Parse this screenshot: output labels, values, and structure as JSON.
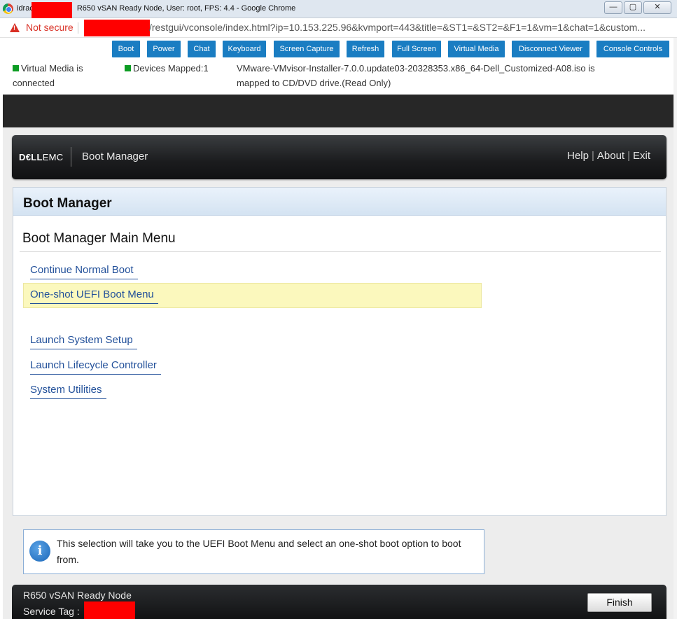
{
  "window": {
    "title_prefix": "idrac",
    "title_suffix": "R650 vSAN Ready Node, User: root, FPS: 4.4 - Google Chrome",
    "minimize": "—",
    "maximize": "▢",
    "close": "✕"
  },
  "addressbar": {
    "security_label": "Not secure",
    "url": "/restgui/vconsole/index.html?ip=10.153.225.96&kvmport=443&title=&ST1=&ST2=&F1=1&vm=1&chat=1&custom..."
  },
  "toolbar": {
    "buttons": [
      "Boot",
      "Power",
      "Chat",
      "Keyboard",
      "Screen Capture",
      "Refresh",
      "Full Screen",
      "Virtual Media",
      "Disconnect Viewer",
      "Console Controls"
    ]
  },
  "status": {
    "virtual_media_line1": "Virtual Media is",
    "virtual_media_line2": "connected",
    "devices_mapped": "Devices Mapped:1",
    "iso_line1": "VMware-VMvisor-Installer-7.0.0.update03-20328353.x86_64-Dell_Customized-A08.iso is",
    "iso_line2": "mapped to CD/DVD drive.(Read Only)"
  },
  "header": {
    "logo_bold": "D€LL",
    "logo_rest": "EMC",
    "title": "Boot Manager",
    "help": "Help",
    "about": "About",
    "exit": "Exit",
    "sep": "|"
  },
  "panel": {
    "title": "Boot Manager",
    "menu_title": "Boot Manager Main Menu",
    "items": [
      "Continue Normal Boot",
      "One-shot UEFI Boot Menu",
      "Launch System Setup",
      "Launch Lifecycle Controller",
      "System Utilities"
    ],
    "selected_index": 1
  },
  "help": {
    "icon": "i",
    "text": "This selection will take you to the UEFI Boot Menu and select an one-shot boot option to boot from."
  },
  "footer": {
    "model": "R650 vSAN Ready Node",
    "service_tag_label": "Service Tag :",
    "finish": "Finish"
  },
  "colors": {
    "toolbar_button": "#1a7dc2",
    "link": "#22509a",
    "highlight": "#fbf8bd",
    "status_green": "#0d9c23",
    "warning_red": "#d93025",
    "redaction": "#ff0000"
  }
}
